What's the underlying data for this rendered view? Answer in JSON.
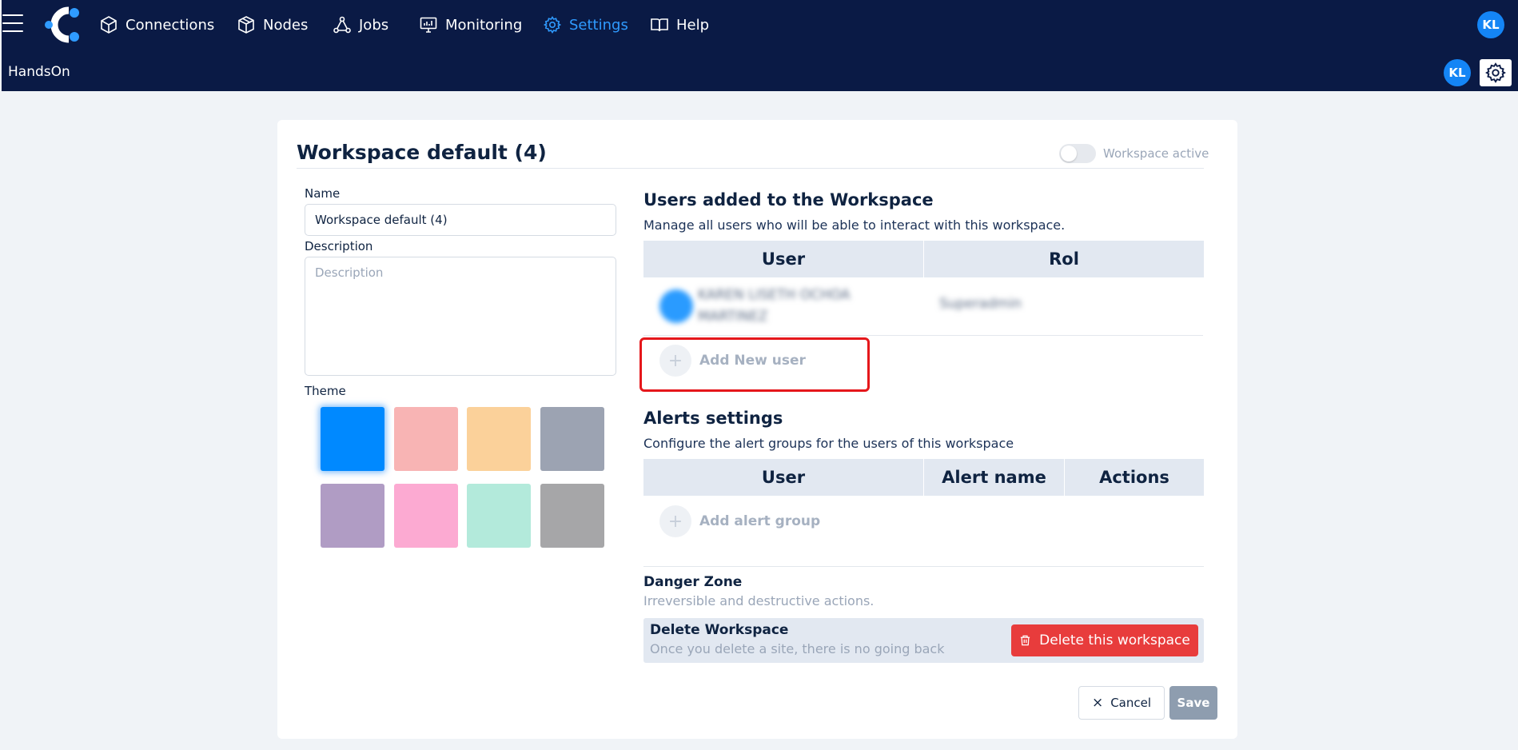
{
  "nav": {
    "items": [
      {
        "label": "Connections",
        "icon": "cube-icon"
      },
      {
        "label": "Nodes",
        "icon": "boxes-icon"
      },
      {
        "label": "Jobs",
        "icon": "share-nodes-icon"
      },
      {
        "label": "Monitoring",
        "icon": "monitor-icon"
      },
      {
        "label": "Settings",
        "icon": "gear-icon",
        "active": true
      },
      {
        "label": "Help",
        "icon": "book-icon"
      }
    ],
    "user_initials": "KL",
    "active_color": "#2f9bff",
    "background": "#0a1a45"
  },
  "subbar": {
    "brand": "HandsOn",
    "user_initials": "KL"
  },
  "workspace": {
    "title": "Workspace default (4)",
    "active_label": "Workspace active",
    "active": false
  },
  "form": {
    "name_label": "Name",
    "name_value": "Workspace default (4)",
    "description_label": "Description",
    "description_placeholder": "Description",
    "theme_label": "Theme",
    "theme_colors": [
      "#0089ff",
      "#f8b4b4",
      "#fbd19a",
      "#9ca3b2",
      "#b09cc4",
      "#fcaad2",
      "#b3eadb",
      "#a6a6a8"
    ],
    "theme_selected_index": 0
  },
  "users_section": {
    "title": "Users added to the Workspace",
    "subtitle": "Manage all users who will be able to interact with this workspace.",
    "columns": [
      "User",
      "Rol"
    ],
    "rows": [
      {
        "name": "KAREN LISETH OCHOA MARTINEZ",
        "role": "Superadmin"
      }
    ],
    "add_label": "Add New user"
  },
  "alerts_section": {
    "title": "Alerts settings",
    "subtitle": "Configure the alert groups for the users of this workspace",
    "columns": [
      "User",
      "Alert name",
      "Actions"
    ],
    "add_label": "Add alert group"
  },
  "danger_zone": {
    "title": "Danger Zone",
    "subtitle": "Irreversible and destructive actions.",
    "item_title": "Delete Workspace",
    "item_subtitle": "Once you delete a site, there is no going back",
    "button_label": "Delete this workspace",
    "button_color": "#e83c3c"
  },
  "footer": {
    "cancel_label": "Cancel",
    "save_label": "Save"
  }
}
